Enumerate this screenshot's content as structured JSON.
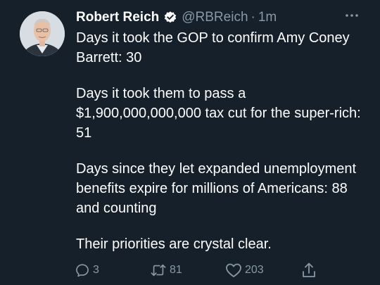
{
  "tweet": {
    "author_name": "Robert Reich",
    "handle": "@RBReich",
    "separator": "·",
    "time": "1m",
    "paragraphs": [
      "Days it took the GOP to confirm Amy Coney Barrett: 30",
      "Days it took them to pass a $1,900,000,000,000 tax cut for the super-rich: 51",
      "Days since they let expanded unemployment benefits expire for millions of Americans: 88 and counting",
      "Their priorities are crystal clear."
    ],
    "reply_count": "3",
    "retweet_count": "81",
    "like_count": "203"
  },
  "icons": {
    "verified": "verified-badge-icon",
    "more": "more-horizontal-icon",
    "reply": "reply-icon",
    "retweet": "retweet-icon",
    "like": "heart-icon",
    "share": "share-icon"
  },
  "colors": {
    "background": "#15202b",
    "text": "#ffffff",
    "secondary": "#8899a6",
    "verified": "#ffffff"
  }
}
